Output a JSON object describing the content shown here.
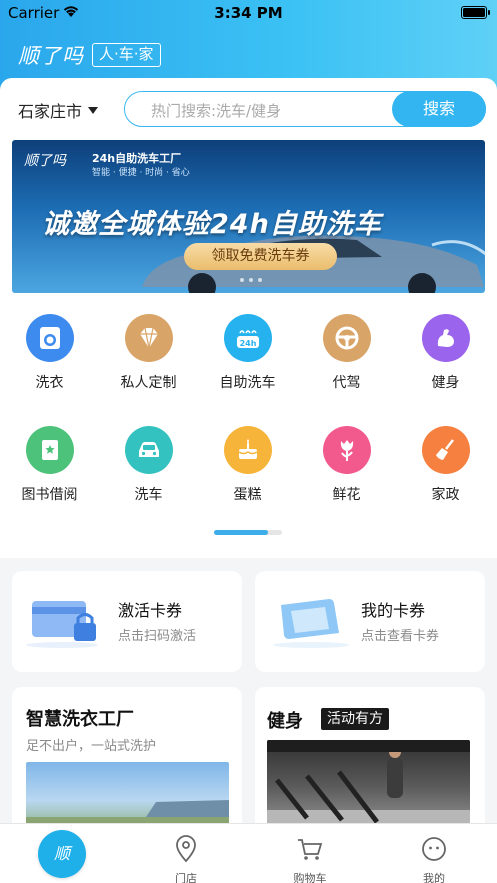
{
  "status_bar": {
    "carrier": "Carrier",
    "time": "3:34 PM"
  },
  "brand": {
    "logo": "顺了吗",
    "tag": "人·车·家"
  },
  "location": {
    "city": "石家庄市"
  },
  "search": {
    "placeholder": "热门搜索:洗车/健身",
    "button": "搜索"
  },
  "banner": {
    "logo": "顺了吗",
    "subtitle": "24h自助洗车工厂",
    "tagline": "智能 · 便捷 · 时尚 · 省心",
    "headline": "诚邀全城体验24h自助洗车",
    "cta": "领取免费洗车券"
  },
  "services": [
    {
      "label": "洗衣",
      "icon": "washing-machine-icon",
      "color": "#3e8bf0"
    },
    {
      "label": "私人定制",
      "icon": "diamond-icon",
      "color": "#d9a467"
    },
    {
      "label": "自助洗车",
      "icon": "car-wash-24h-icon",
      "color": "#26b2ee"
    },
    {
      "label": "代驾",
      "icon": "steering-wheel-icon",
      "color": "#d9a467"
    },
    {
      "label": "健身",
      "icon": "flexed-arm-icon",
      "color": "#9a64ec"
    },
    {
      "label": "图书借阅",
      "icon": "book-icon",
      "color": "#4cc27a"
    },
    {
      "label": "洗车",
      "icon": "car-icon",
      "color": "#33c2bf"
    },
    {
      "label": "蛋糕",
      "icon": "cake-icon",
      "color": "#f6b53a"
    },
    {
      "label": "鲜花",
      "icon": "flower-icon",
      "color": "#f25a8e"
    },
    {
      "label": "家政",
      "icon": "broom-icon",
      "color": "#f5803f"
    }
  ],
  "cards": {
    "activate": {
      "title": "激活卡券",
      "subtitle": "点击扫码激活"
    },
    "my_coupons": {
      "title": "我的卡券",
      "subtitle": "点击查看卡券"
    },
    "laundry": {
      "title": "智慧洗衣工厂",
      "subtitle": "足不出户，一站式洗护"
    },
    "fitness": {
      "title": "健身",
      "badge": "活动有方"
    }
  },
  "tabbar": {
    "home": "顺",
    "store": "门店",
    "cart": "购物车",
    "mine": "我的"
  }
}
